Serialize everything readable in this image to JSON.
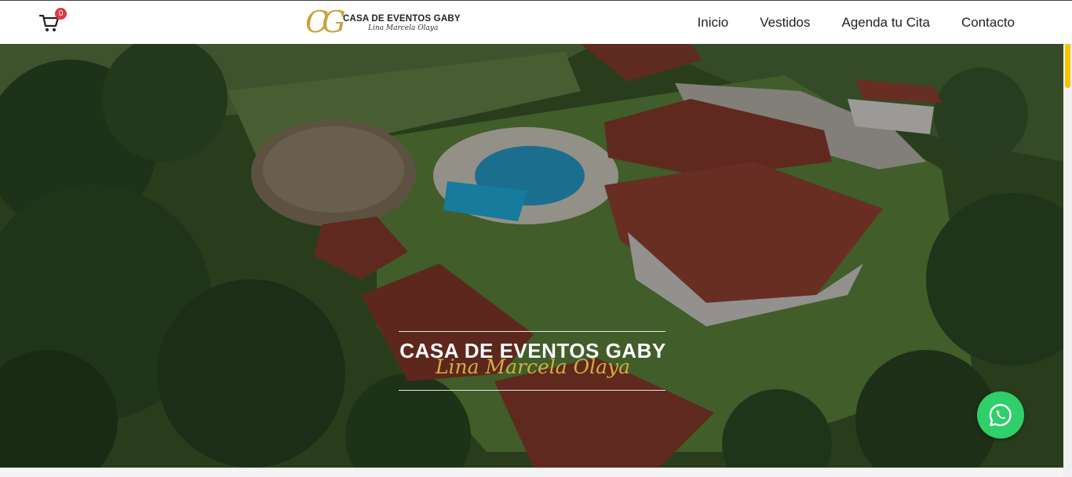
{
  "header": {
    "cart": {
      "icon": "shopping-cart-icon",
      "count": "0"
    },
    "logo": {
      "monogram": "CG",
      "title": "CASA DE EVENTOS GABY",
      "subtitle": "Lina Marcela Olaya",
      "accent_color": "#c9a13a"
    },
    "nav": [
      {
        "label": "Inicio"
      },
      {
        "label": "Vestidos"
      },
      {
        "label": "Agenda tu Cita"
      },
      {
        "label": "Contacto"
      }
    ]
  },
  "hero": {
    "title": "CASA DE EVENTOS GABY",
    "subtitle": "Lina Marcela Olaya",
    "subtitle_color": "#d6ad3f",
    "background": "aerial-photo-country-house-with-pool"
  },
  "whatsapp": {
    "icon": "whatsapp-icon",
    "color": "#2fcf6a"
  },
  "scrollbar": {
    "thumb_color": "#f5c400"
  }
}
